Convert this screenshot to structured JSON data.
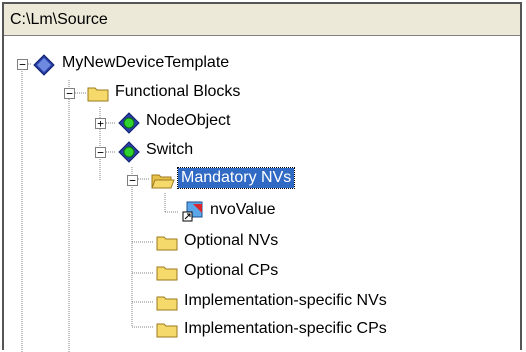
{
  "header": {
    "path": "C:\\Lm\\Source"
  },
  "tree": {
    "root": {
      "label": "MyNewDeviceTemplate",
      "expander": "−"
    },
    "functional_blocks": {
      "label": "Functional Blocks",
      "expander": "−"
    },
    "node_object": {
      "label": "NodeObject",
      "expander": "+"
    },
    "switch": {
      "label": "Switch",
      "expander": "−"
    },
    "mandatory_nvs": {
      "label": "Mandatory NVs",
      "expander": "−",
      "selected": true
    },
    "nvo_value": {
      "label": "nvoValue"
    },
    "optional_nvs": {
      "label": "Optional NVs"
    },
    "optional_cps": {
      "label": "Optional CPs"
    },
    "impl_nvs": {
      "label": "Implementation-specific NVs"
    },
    "impl_cps": {
      "label": "Implementation-specific CPs"
    }
  },
  "colors": {
    "selection": "#316ac5",
    "header_bg": "#ece9d8",
    "folder": "#f5d96b",
    "diamond": "#2a3fa8"
  }
}
